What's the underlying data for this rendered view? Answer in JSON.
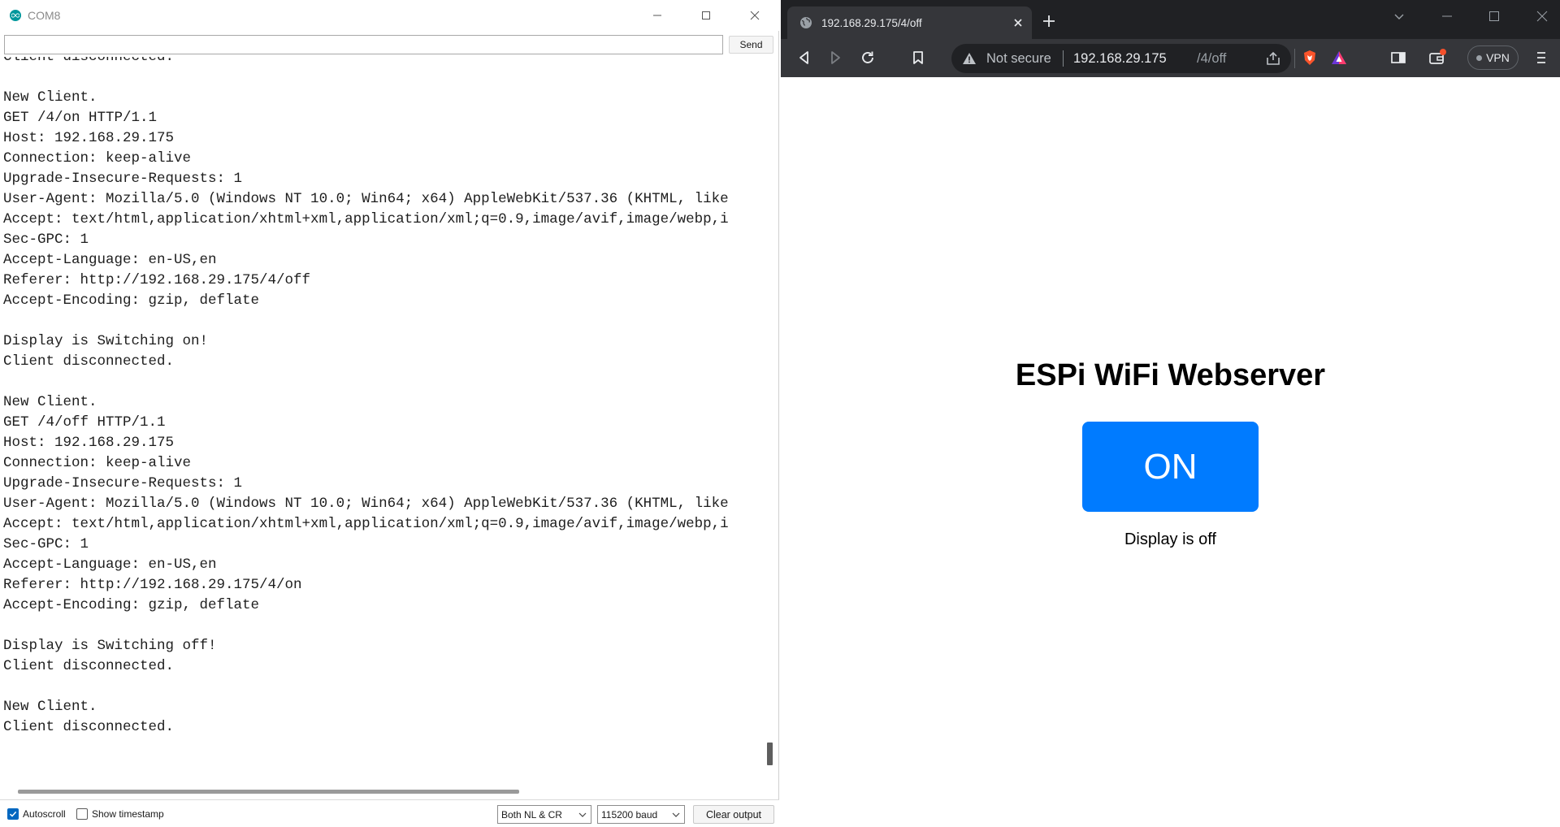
{
  "serial_monitor": {
    "title": "COM8",
    "send_input_value": "",
    "send_label": "Send",
    "output_lines": [
      "Client disconnected.",
      "",
      "New Client.",
      "GET /4/on HTTP/1.1",
      "Host: 192.168.29.175",
      "Connection: keep-alive",
      "Upgrade-Insecure-Requests: 1",
      "User-Agent: Mozilla/5.0 (Windows NT 10.0; Win64; x64) AppleWebKit/537.36 (KHTML, like",
      "Accept: text/html,application/xhtml+xml,application/xml;q=0.9,image/avif,image/webp,i",
      "Sec-GPC: 1",
      "Accept-Language: en-US,en",
      "Referer: http://192.168.29.175/4/off",
      "Accept-Encoding: gzip, deflate",
      "",
      "Display is Switching on!",
      "Client disconnected.",
      "",
      "New Client.",
      "GET /4/off HTTP/1.1",
      "Host: 192.168.29.175",
      "Connection: keep-alive",
      "Upgrade-Insecure-Requests: 1",
      "User-Agent: Mozilla/5.0 (Windows NT 10.0; Win64; x64) AppleWebKit/537.36 (KHTML, like",
      "Accept: text/html,application/xhtml+xml,application/xml;q=0.9,image/avif,image/webp,i",
      "Sec-GPC: 1",
      "Accept-Language: en-US,en",
      "Referer: http://192.168.29.175/4/on",
      "Accept-Encoding: gzip, deflate",
      "",
      "Display is Switching off!",
      "Client disconnected.",
      "",
      "New Client.",
      "Client disconnected."
    ],
    "autoscroll_label": "Autoscroll",
    "autoscroll_checked": true,
    "show_timestamp_label": "Show timestamp",
    "show_timestamp_checked": false,
    "line_ending_selected": "Both NL & CR",
    "baud_selected": "115200 baud",
    "clear_output_label": "Clear output",
    "accent_color": "#00979c"
  },
  "browser": {
    "tab_title": "192.168.29.175/4/off",
    "security_label": "Not secure",
    "url_host": "192.168.29.175",
    "url_path": "/4/off",
    "vpn_label": "VPN",
    "page": {
      "heading": "ESPi WiFi Webserver",
      "button_label": "ON",
      "button_color": "#007bff",
      "status_text": "Display is off"
    }
  }
}
